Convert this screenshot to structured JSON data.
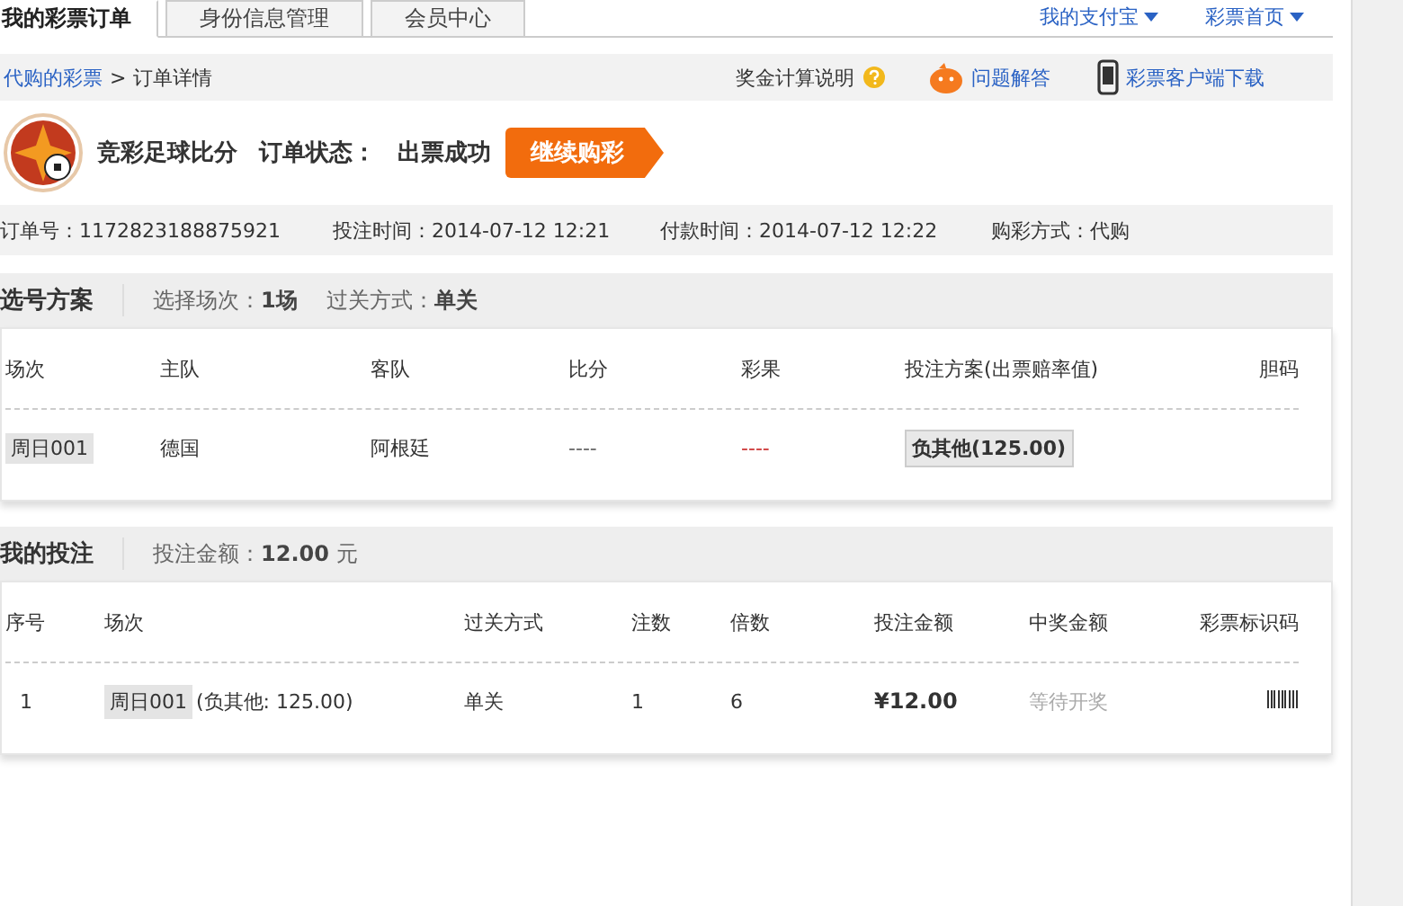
{
  "tabs": [
    {
      "label": "我的彩票订单",
      "selected": true
    },
    {
      "label": "身份信息管理",
      "selected": false
    },
    {
      "label": "会员中心",
      "selected": false
    }
  ],
  "top_links": [
    "我的支付宝",
    "彩票首页"
  ],
  "breadcrumb": {
    "link": "代购的彩票",
    "separator": ">",
    "current": "订单详情"
  },
  "help_links": [
    "奖金计算说明",
    "问题解答",
    "彩票客户端下载"
  ],
  "order": {
    "game": "竞彩足球比分",
    "status_label": "订单状态：",
    "status": "出票成功",
    "button": "继续购彩"
  },
  "order_info": [
    {
      "label": "订单号：",
      "value": "1172823188875921"
    },
    {
      "label": "投注时间：",
      "value": "2014-07-12 12:21"
    },
    {
      "label": "付款时间：",
      "value": "2014-07-12 12:22"
    },
    {
      "label": "购彩方式：",
      "value": "代购"
    }
  ],
  "plan": {
    "title": "选号方案",
    "meta": [
      {
        "label": "选择场次：",
        "value": "1场"
      },
      {
        "label": "过关方式：",
        "value": "单关"
      }
    ],
    "columns": [
      "场次",
      "主队",
      "客队",
      "比分",
      "彩果",
      "投注方案(出票赔率值)",
      "胆码"
    ],
    "rows": [
      {
        "match": "周日001",
        "home": "德国",
        "away": "阿根廷",
        "score": "----",
        "result": "----",
        "bet": "负其他(125.00)"
      }
    ]
  },
  "bets": {
    "title": "我的投注",
    "meta": [
      {
        "label": "投注金额：",
        "value": "12.00",
        "unit": "元"
      }
    ],
    "columns": [
      "序号",
      "场次",
      "过关方式",
      "注数",
      "倍数",
      "投注金额",
      "中奖金额",
      "彩票标识码"
    ],
    "rows": [
      {
        "index": "1",
        "match": "周日001",
        "detail": "(负其他: 125.00)",
        "pass": "单关",
        "count": "1",
        "multiple": "6",
        "amount": "¥12.00",
        "prize": "等待开奖"
      }
    ]
  }
}
